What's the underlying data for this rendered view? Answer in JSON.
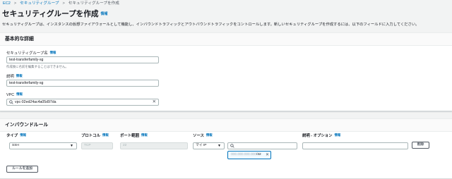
{
  "breadcrumb": {
    "items": [
      "EC2",
      "セキュリティグループ",
      "セキュリティグループを作成"
    ],
    "separator": ">"
  },
  "header": {
    "title": "セキュリティグループを作成",
    "title_info": "情報",
    "description": "セキュリティグループは、インスタンスの仮想ファイアウォールとして機能し、インバウンドトラフィックとアウトバウンドトラフィックをコントロールします。新しいセキュリティグループを作成するには、以下のフィールドに入力してください。"
  },
  "basic_details": {
    "title": "基本的な詳細",
    "name_label": "セキュリティグループ名",
    "name_info": "情報",
    "name_value": "test-transferfamily-sg",
    "name_hint": "作成後に名前を編集することはできません。",
    "desc_label": "説明",
    "desc_info": "情報",
    "desc_value": "test-transferfamily-sg",
    "vpc_label": "VPC",
    "vpc_info": "情報",
    "vpc_value": "vpc-02ed24ac4a05d97da",
    "vpc_clear": "✕"
  },
  "inbound": {
    "title": "インバウンドルール",
    "columns": [
      {
        "label": "タイプ",
        "info": "情報"
      },
      {
        "label": "プロトコル",
        "info": "情報"
      },
      {
        "label": "ポート範囲",
        "info": "情報"
      },
      {
        "label": "ソース",
        "info": "情報"
      },
      {
        "label": "説明 - オプション",
        "info": "情報"
      }
    ],
    "rule": {
      "type": "SSH",
      "protocol": "TCP",
      "port": "22",
      "source": "マイ IP",
      "source_search": "",
      "cidr_masked": "000.000.000.000",
      "cidr_suffix": "/32",
      "description": "",
      "delete_label": "削除"
    },
    "add_rule_label": "ルールを追加"
  },
  "colors": {
    "link": "#0073bb",
    "page_bg": "#f2f3f3",
    "panel_header_bg": "#fafafa",
    "token_bg": "#f1faff"
  }
}
